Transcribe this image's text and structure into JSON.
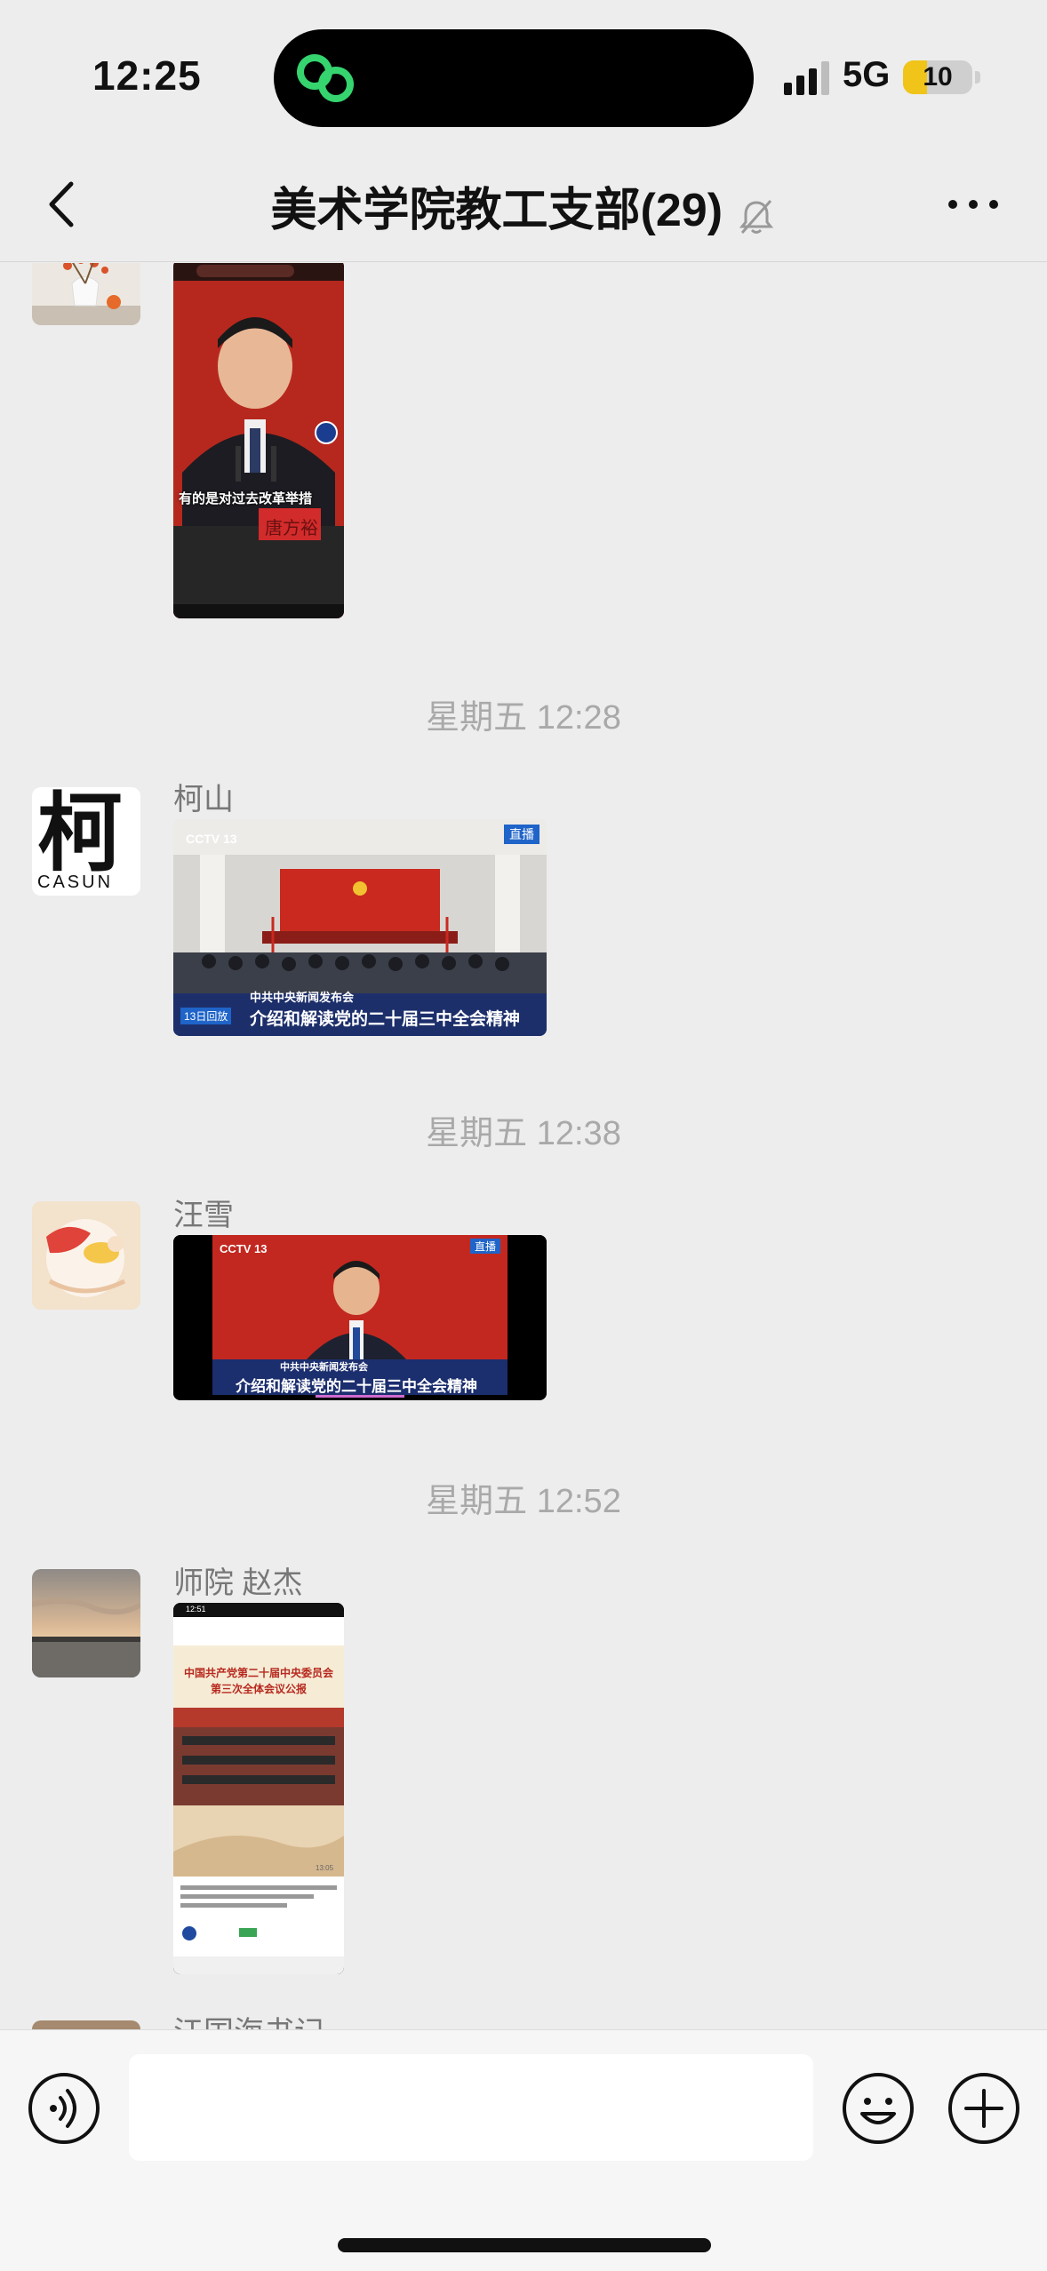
{
  "status_bar": {
    "time": "12:25",
    "network": "5G",
    "battery": "10",
    "battery_level": 0.1
  },
  "header": {
    "title": "美术学院教工支部(29)",
    "back_icon": "chevron-left-icon",
    "mute_icon": "bell-off-icon",
    "more_icon": "more-dots-icon"
  },
  "messages": {
    "m0": {
      "video_caption": "有的是对过去改革举措",
      "name_card": "唐方裕"
    },
    "t1": "星期五 12:28",
    "m1": {
      "sender": "柯山",
      "avatar_text": "柯",
      "avatar_sub": "CASUN",
      "video_logo": "CCTV 13",
      "video_badge": "直播",
      "video_tag": "中共中央新闻发布会",
      "video_title": "介绍和解读党的二十届三中全会精神",
      "video_side": "13日回放"
    },
    "t2": "星期五 12:38",
    "m2": {
      "sender": "汪雪",
      "video_logo": "CCTV 13",
      "video_badge": "直播",
      "video_tag": "中共中央新闻发布会",
      "video_title": "介绍和解读党的二十届三中全会精神"
    },
    "t3": "星期五 12:52",
    "m3": {
      "sender": "师院 赵杰",
      "phone_time": "12:51",
      "doc_title_1": "中国共产党第二十届中央委员会",
      "doc_title_2": "第三次全体会议公报",
      "duration": "13:05"
    },
    "m4": {
      "sender": "江国海书记"
    }
  },
  "input_bar": {
    "voice_icon": "voice-icon",
    "emoji_icon": "emoji-icon",
    "plus_icon": "plus-circle-icon",
    "placeholder": ""
  },
  "colors": {
    "background": "#ededed",
    "accent_green": "#2fd36f",
    "battery_yellow": "#f0c419",
    "video_red": "#c7281f"
  }
}
